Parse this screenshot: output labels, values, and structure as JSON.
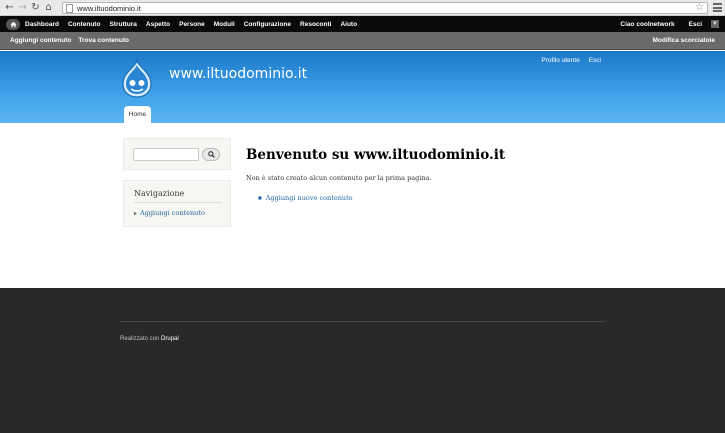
{
  "browser": {
    "url": "www.iltuodominio.it"
  },
  "toolbar": {
    "items": [
      "Dashboard",
      "Contenuto",
      "Struttura",
      "Aspetto",
      "Persone",
      "Moduli",
      "Configurazione",
      "Resoconti",
      "Aiuto"
    ],
    "greeting_prefix": "Ciao ",
    "user": "coolnetwork",
    "logout": "Esci"
  },
  "shortcuts": {
    "items": [
      "Aggiungi contenuto",
      "Trova contenuto"
    ],
    "edit": "Modifica scorciatoie"
  },
  "header": {
    "site_name": "www.iltuodominio.it",
    "secondary_menu": [
      "Profilo utente",
      "Esci"
    ],
    "main_tab": "Home"
  },
  "sidebar": {
    "nav_title": "Navigazione",
    "nav_link": "Aggiungi contenuto"
  },
  "content": {
    "title": "Benvenuto su www.iltuodominio.it",
    "empty_message": "Non è stato creato alcun contenuto per la prima pagina.",
    "add_link": "Aggiungi nuovo contenuto"
  },
  "footer": {
    "credit_prefix": "Realizzato con ",
    "credit_link": "Drupal"
  }
}
